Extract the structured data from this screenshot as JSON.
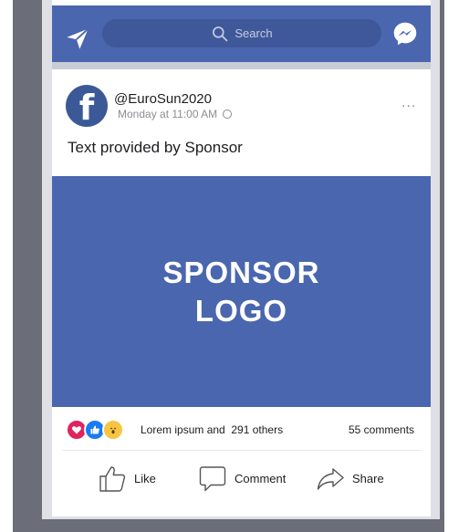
{
  "header": {
    "send_icon": "paper-plane-icon",
    "search_placeholder": "Search",
    "messenger_icon": "messenger-icon",
    "bar_color": "#4a66ae"
  },
  "post": {
    "avatar_letter": "f",
    "handle": "@EuroSun2020",
    "timestamp": "Monday at 11:00 AM",
    "more": "...",
    "text": "Text provided by Sponsor",
    "sponsor_line1": "SPONSOR",
    "sponsor_line2": "LOGO"
  },
  "engagement": {
    "reactions": [
      "love",
      "like",
      "wow"
    ],
    "reactions_label": "Lorem ipsum and  291 others",
    "comments": "55 comments"
  },
  "actions": {
    "like": "Like",
    "comment": "Comment",
    "share": "Share"
  }
}
